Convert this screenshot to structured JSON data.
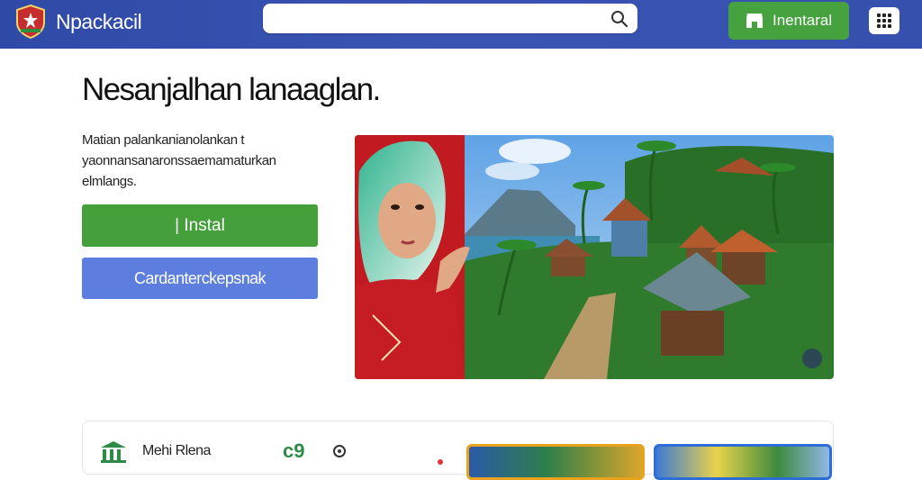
{
  "header": {
    "brand": "Npackacil",
    "search_placeholder": "",
    "install_label": "Inentaral",
    "logo_icon": "flag-emblem-icon",
    "menu_icon": "grid-menu-icon",
    "search_icon": "search-icon",
    "store_icon": "store-icon"
  },
  "hero": {
    "title": "Nesanjalhan lanaaglan.",
    "description": "Matian palankanianolankan t yaonnansanaronssaemamaturkan elmlangs.",
    "primary_button": "| Instal",
    "secondary_button": "Cardanterckepsnak"
  },
  "bottom_card": {
    "label": "Mehi Rlena",
    "stat": "c9",
    "bank_icon": "bank-icon",
    "glyph_icon": "settings-glyph-icon"
  },
  "colors": {
    "header_bg": "#3550ad",
    "install_green": "#45a23f",
    "secondary_blue": "#5d7ede",
    "stat_green": "#2e8b45"
  }
}
